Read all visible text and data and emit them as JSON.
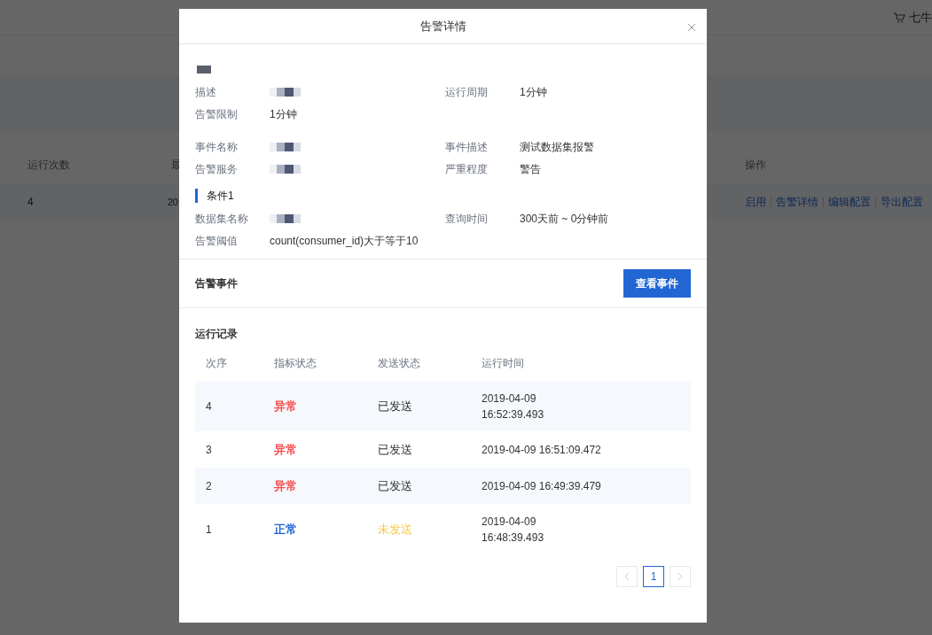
{
  "background": {
    "brand": "七牛",
    "table": {
      "columns": [
        "运行次数",
        "最",
        "操作"
      ],
      "rows": [
        {
          "cells": [
            "4",
            "20"
          ],
          "actions": [
            "启用",
            "告警详情",
            "编辑配置",
            "导出配置"
          ]
        }
      ]
    }
  },
  "dialog": {
    "title": "告警详情",
    "name_redacted": true,
    "info_groups": [
      [
        {
          "label": "描述",
          "redacted": true
        },
        {
          "label": "运行周期",
          "value": "1分钟"
        },
        {
          "label": "告警限制",
          "value": "1分钟"
        }
      ],
      [
        {
          "label": "事件名称",
          "redacted": true
        },
        {
          "label": "事件描述",
          "value": "测试数据集报警"
        },
        {
          "label": "告警服务",
          "redacted": true
        },
        {
          "label": "严重程度",
          "value": "警告"
        }
      ]
    ],
    "condition": {
      "title": "条件1",
      "fields": [
        {
          "label": "数据集名称",
          "redacted": true
        },
        {
          "label": "查询时间",
          "value": "300天前 ~ 0分钟前"
        },
        {
          "label": "告警阈值",
          "value": "count(consumer_id)大于等于10"
        }
      ]
    },
    "events": {
      "title": "告警事件",
      "button": "查看事件"
    },
    "records": {
      "title": "运行记录",
      "columns": [
        "次序",
        "指标状态",
        "发送状态",
        "运行时间"
      ],
      "rows": [
        {
          "index": "4",
          "metric": {
            "text": "异常",
            "color": "#f5504f"
          },
          "send": {
            "text": "已发送",
            "color": "#333333"
          },
          "time": [
            "2019-04-09",
            "16:52:39.493"
          ]
        },
        {
          "index": "3",
          "metric": {
            "text": "异常",
            "color": "#f5504f"
          },
          "send": {
            "text": "已发送",
            "color": "#333333"
          },
          "time": [
            "2019-04-09 16:51:09.472"
          ]
        },
        {
          "index": "2",
          "metric": {
            "text": "异常",
            "color": "#f5504f"
          },
          "send": {
            "text": "已发送",
            "color": "#333333"
          },
          "time": [
            "2019-04-09 16:49:39.479"
          ]
        },
        {
          "index": "1",
          "metric": {
            "text": "正常",
            "color": "#2266d4"
          },
          "send": {
            "text": "未发送",
            "color": "#f7c948"
          },
          "time": [
            "2019-04-09",
            "16:48:39.493"
          ]
        }
      ]
    },
    "pagination": {
      "prev_disabled": true,
      "next_disabled": true,
      "pages": [
        {
          "label": "1",
          "selected": true
        }
      ]
    }
  }
}
